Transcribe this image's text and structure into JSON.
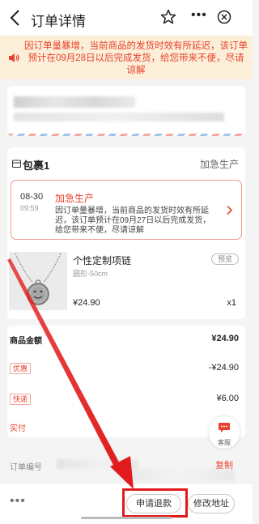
{
  "header": {
    "title": "订单详情",
    "more_label": "•••"
  },
  "notice": {
    "text": "因订单量暴增，当前商品的发货时效有所延迟，该订单预计在09月28日以后完成发货，给您带来不便，尽请谅解"
  },
  "package": {
    "title": "包裹1",
    "status": "加急生产",
    "urgent": {
      "date": "08-30",
      "time": "09:59",
      "title": "加急生产",
      "text": "因订单量暴增，当前商品的发货时效有所延迟，该订单预计在09月27日以后完成发货，给您带来不便，尽请谅解"
    },
    "product": {
      "name": "个性定制项链",
      "spec": "圆形-50cm",
      "preview_label": "预览",
      "price": "¥24.90",
      "qty": "x1"
    }
  },
  "amounts": {
    "goods_label": "商品金额",
    "goods_value": "¥24.90",
    "discount_tag": "优惠",
    "discount_value": "-¥24.90",
    "shipping_tag": "快递",
    "shipping_value": "¥6.00",
    "paid_label": "实付"
  },
  "customer_service": {
    "label": "客服"
  },
  "order": {
    "number_label": "订单编号",
    "copy_label": "复制"
  },
  "bottom_bar": {
    "more_label": "•••",
    "refund_label": "申请退款",
    "modify_address_label": "修改地址"
  },
  "colors": {
    "accent": "#e8412b",
    "notice_bg": "#fcefd9",
    "annotation": "#e11b1b"
  }
}
